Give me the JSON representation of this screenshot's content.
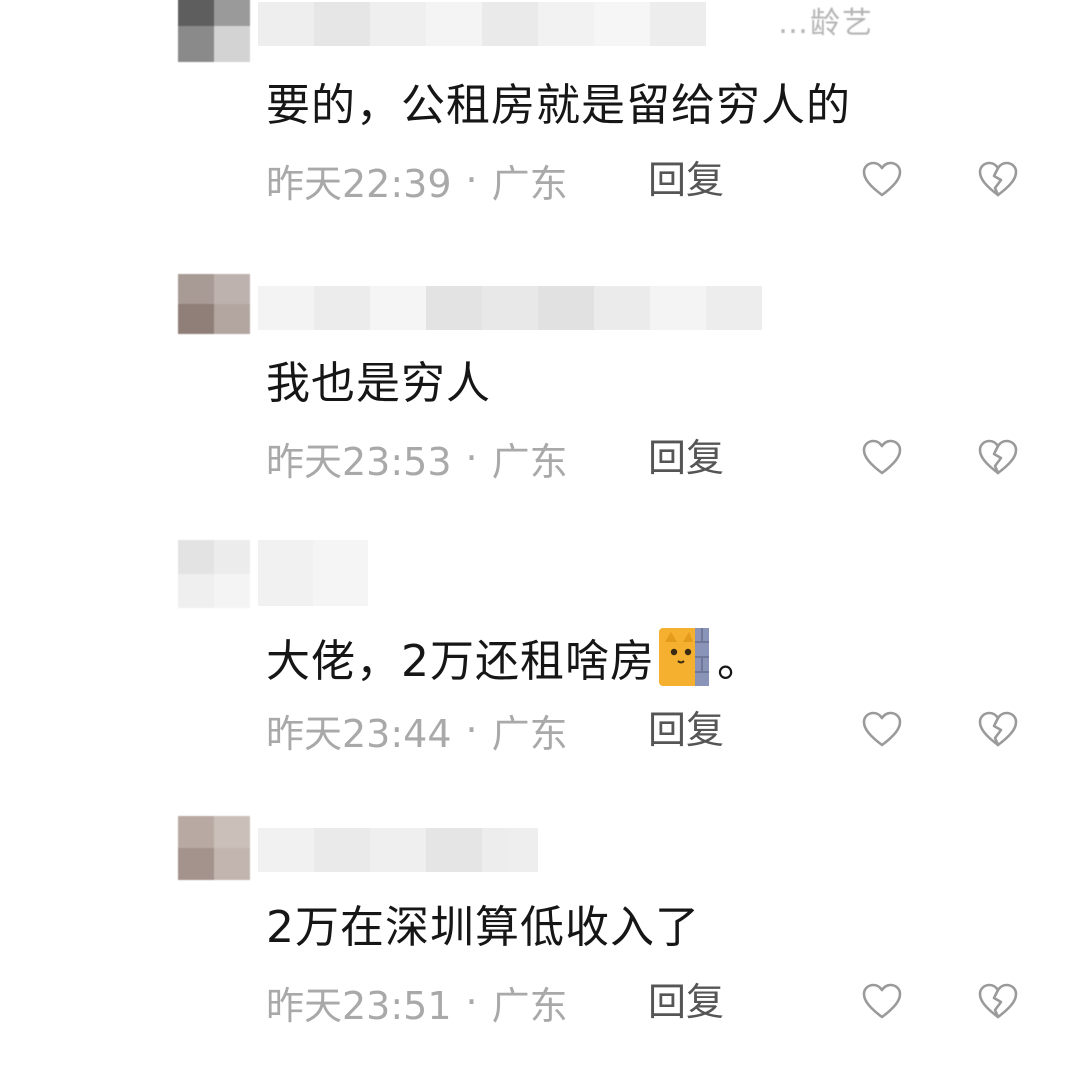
{
  "comments": [
    {
      "name_fragment": "…龄艺",
      "text": "要的，公租房就是留给穷人的",
      "time": "昨天22:39",
      "location": "广东",
      "reply_label": "回复"
    },
    {
      "name_fragment": "",
      "text": "我也是穷人",
      "time": "昨天23:53",
      "location": "广东",
      "reply_label": "回复"
    },
    {
      "name_fragment": "",
      "text_before_emoji": "大佬，2万还租啥房",
      "text_after_emoji": "。",
      "emoji": "cat-peeking-wall-emoji",
      "time": "昨天23:44",
      "location": "广东",
      "reply_label": "回复"
    },
    {
      "name_fragment": "",
      "text": "2万在深圳算低收入了",
      "time": "昨天23:51",
      "location": "广东",
      "reply_label": "回复"
    }
  ],
  "icons": {
    "like": "heart-outline-icon",
    "dislike": "broken-heart-icon"
  },
  "colors": {
    "meta_text": "#a9a9a9",
    "body_text": "#161616",
    "icon_stroke": "#9a9a9a"
  }
}
